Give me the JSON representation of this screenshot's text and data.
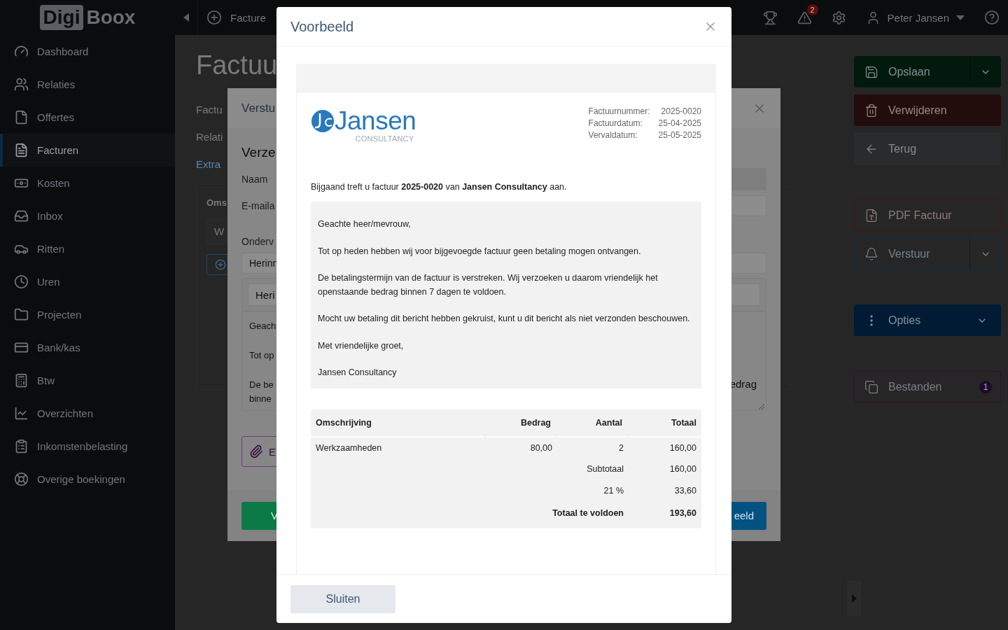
{
  "sidebar": {
    "logo": {
      "boxed": "Digi",
      "plain": "Boox"
    },
    "items": [
      {
        "label": "Dashboard",
        "selected": false
      },
      {
        "label": "Relaties",
        "selected": false
      },
      {
        "label": "Offertes",
        "selected": false
      },
      {
        "label": "Facturen",
        "selected": true
      },
      {
        "label": "Kosten",
        "selected": false
      },
      {
        "label": "Inbox",
        "selected": false
      },
      {
        "label": "Ritten",
        "selected": false
      },
      {
        "label": "Uren",
        "selected": false
      },
      {
        "label": "Projecten",
        "selected": false
      },
      {
        "label": "Bank/kas",
        "selected": false
      },
      {
        "label": "Btw",
        "selected": false
      },
      {
        "label": "Overzichten",
        "selected": false
      },
      {
        "label": "Inkomstenbelasting",
        "selected": false
      },
      {
        "label": "Overige boekingen",
        "selected": false
      }
    ]
  },
  "topbar": {
    "breadcrumb": "Facture",
    "alerts_badge": "2",
    "user": "Peter Jansen"
  },
  "page": {
    "title": "Factuu",
    "fields": [
      "Factu",
      "Relati"
    ],
    "link": "Extra",
    "table_header": "Oms",
    "row_value": "W"
  },
  "actions": [
    {
      "label": "Opslaan",
      "kind": "solid",
      "color": "#021a0e",
      "split_menu": true
    },
    {
      "label": "Verwijderen",
      "kind": "solid",
      "color": "#230c0c"
    },
    {
      "label": "Terug",
      "kind": "plain",
      "color": "#2a2b2d"
    },
    {
      "label": "PDF Factuur",
      "kind": "outline",
      "color": "#4a1515"
    },
    {
      "label": "Verstuur",
      "kind": "outline",
      "color": "#0c2d4a",
      "split_menu": true
    },
    {
      "label": "Opties",
      "kind": "solid",
      "color": "#001b33",
      "menu_caret": true
    },
    {
      "label": "Bestanden",
      "kind": "outline",
      "color": "#2a1232",
      "badge": "1"
    }
  ],
  "send_dialog": {
    "title": "Verstu",
    "heading": "Verze",
    "labels": [
      "Naam",
      "E-maila",
      "Onderv"
    ],
    "subject_value": "Herinn",
    "template_value": "Heri",
    "message_lines": [
      {
        "left": "Geach"
      },
      {
        "left": "Tot op"
      },
      {
        "left": "De be",
        "right": "edrag"
      },
      {
        "left": "binne"
      }
    ],
    "attach_button": "E",
    "send_button": "V",
    "preview_button": "eeld"
  },
  "preview": {
    "title": "Voorbeeld",
    "company": {
      "name": "Jansen",
      "tagline": "CONSULTANCY"
    },
    "meta": [
      {
        "label": "Factuurnummer:",
        "value": "2025-0020"
      },
      {
        "label": "Factuurdatum:",
        "value": "25-04-2025"
      },
      {
        "label": "Vervaldatum:",
        "value": "25-05-2025"
      }
    ],
    "intro": "Bijgaand treft u factuur **2025-0020** van **Jansen Consultancy** aan.",
    "message": [
      "Geachte heer/mevrouw,",
      "Tot op heden hebben wij voor bijgevoegde factuur geen betaling mogen ontvangen.",
      "De betalingstermijn van de factuur is verstreken. Wij verzoeken u daarom vriendelijk het openstaande bedrag binnen 7 dagen te voldoen.",
      "Mocht uw betaling dit bericht hebben gekruist, kunt u dit bericht als niet verzonden beschouwen.",
      "Met vriendelijke groet,",
      "Jansen Consultancy"
    ],
    "table": {
      "columns": [
        "Omschrijving",
        "Bedrag",
        "Aantal",
        "Totaal"
      ],
      "rows": [
        [
          "Werkzaamheden",
          "80,00",
          "2",
          "160,00"
        ]
      ],
      "summary": [
        {
          "label": "Subtotaal",
          "value": "160,00",
          "kind": "line"
        },
        {
          "label": "21 %",
          "value": "33,60",
          "kind": "line"
        },
        {
          "label": "Totaal te voldoen",
          "value": "193,60",
          "kind": "total"
        }
      ]
    },
    "buttons": [
      "Sluiten"
    ]
  }
}
